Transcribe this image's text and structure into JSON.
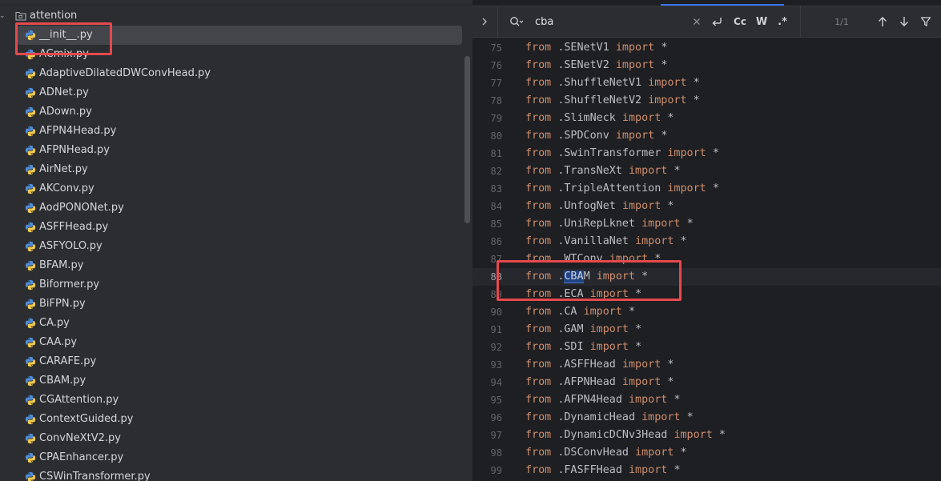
{
  "project_tree": {
    "folder": {
      "name": "attention",
      "icon": "folder-icon",
      "expanded": true
    },
    "files": [
      "__init__.py",
      "ACmix.py",
      "AdaptiveDilatedDWConvHead.py",
      "ADNet.py",
      "ADown.py",
      "AFPN4Head.py",
      "AFPNHead.py",
      "AirNet.py",
      "AKConv.py",
      "AodPONONet.py",
      "ASFFHead.py",
      "ASFYOLO.py",
      "BFAM.py",
      "Biformer.py",
      "BiFPN.py",
      "CA.py",
      "CAA.py",
      "CARAFE.py",
      "CBAM.py",
      "CGAttention.py",
      "ContextGuided.py",
      "ConvNeXtV2.py",
      "CPAEnhancer.py",
      "CSWinTransformer.py"
    ],
    "selected_file": "__init__.py",
    "file_icon": "python-file-icon"
  },
  "find_bar": {
    "query": "cba",
    "match_count": "1/1",
    "toggle_icon": "chevron-right-icon",
    "search_icon": "search-history-icon",
    "clear_icon": "close-icon",
    "newline_icon": "newline-icon",
    "case_label": "Cc",
    "words_label": "W",
    "regex_label": ".*",
    "prev_icon": "arrow-up-icon",
    "next_icon": "arrow-down-icon",
    "filter_icon": "filter-icon"
  },
  "editor": {
    "keyword_from": "from",
    "keyword_import": "import",
    "star": "*",
    "current_line": "88",
    "lines": [
      {
        "n": "75",
        "module": ".SENetV1"
      },
      {
        "n": "76",
        "module": ".SENetV2"
      },
      {
        "n": "77",
        "module": ".ShuffleNetV1"
      },
      {
        "n": "78",
        "module": ".ShuffleNetV2"
      },
      {
        "n": "79",
        "module": ".SlimNeck"
      },
      {
        "n": "80",
        "module": ".SPDConv"
      },
      {
        "n": "81",
        "module": ".SwinTransformer"
      },
      {
        "n": "82",
        "module": ".TransNeXt"
      },
      {
        "n": "83",
        "module": ".TripleAttention"
      },
      {
        "n": "84",
        "module": ".UnfogNet"
      },
      {
        "n": "85",
        "module": ".UniRepLknet"
      },
      {
        "n": "86",
        "module": ".VanillaNet"
      },
      {
        "n": "87",
        "module": ".WTConv"
      },
      {
        "n": "88",
        "module": ".CBAM",
        "match": "CBA"
      },
      {
        "n": "89",
        "module": ".ECA"
      },
      {
        "n": "90",
        "module": ".CA"
      },
      {
        "n": "91",
        "module": ".GAM"
      },
      {
        "n": "92",
        "module": ".SDI"
      },
      {
        "n": "93",
        "module": ".ASFFHead"
      },
      {
        "n": "94",
        "module": ".AFPNHead"
      },
      {
        "n": "95",
        "module": ".AFPN4Head"
      },
      {
        "n": "96",
        "module": ".DynamicHead"
      },
      {
        "n": "97",
        "module": ".DynamicDCNv3Head"
      },
      {
        "n": "98",
        "module": ".DSConvHead"
      },
      {
        "n": "99",
        "module": ".FASFFHead"
      }
    ]
  },
  "colors": {
    "keyword": "#cf8e6d",
    "search_match": "#214283",
    "annotation": "#e5494d",
    "accent": "#3574f0"
  }
}
